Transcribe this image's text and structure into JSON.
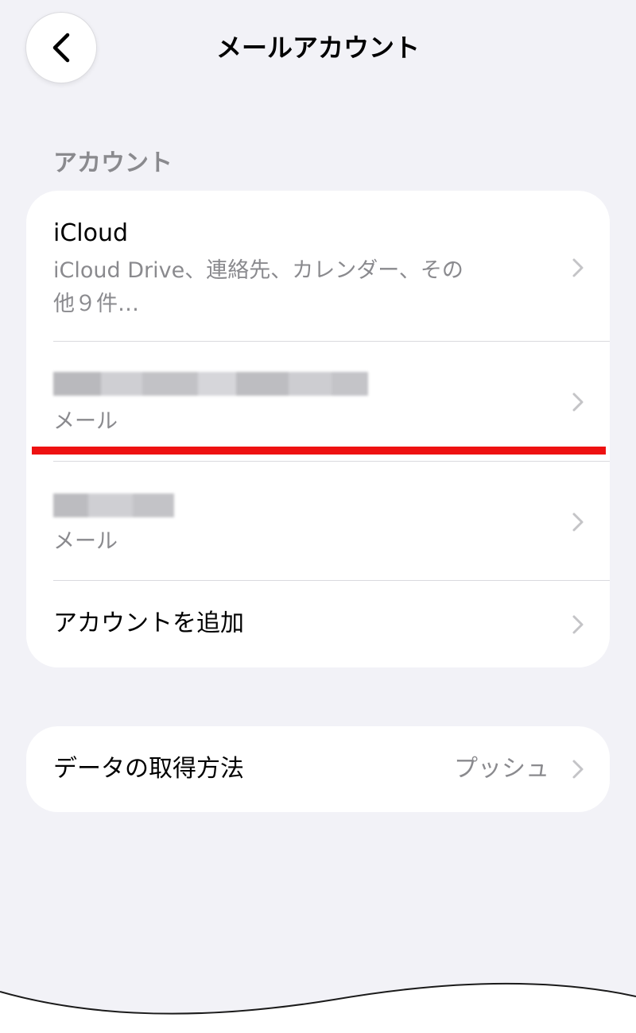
{
  "nav": {
    "title": "メールアカウント"
  },
  "accounts_section": {
    "header": "アカウント",
    "rows": [
      {
        "title": "iCloud",
        "subtitle_line1": "iCloud Drive、連絡先、カレンダー、その",
        "subtitle_line2": "他９件…"
      },
      {
        "subtitle": "メール"
      },
      {
        "subtitle": "メール"
      }
    ],
    "add_account_label": "アカウントを追加"
  },
  "fetch": {
    "label": "データの取得方法",
    "value": "プッシュ"
  },
  "colors": {
    "background": "#f2f2f7",
    "card": "#ffffff",
    "secondary_text": "#8a8a8e",
    "highlight": "#ee1111"
  },
  "icons": {
    "back": "chevron-left-icon",
    "disclosure": "chevron-right-icon"
  }
}
